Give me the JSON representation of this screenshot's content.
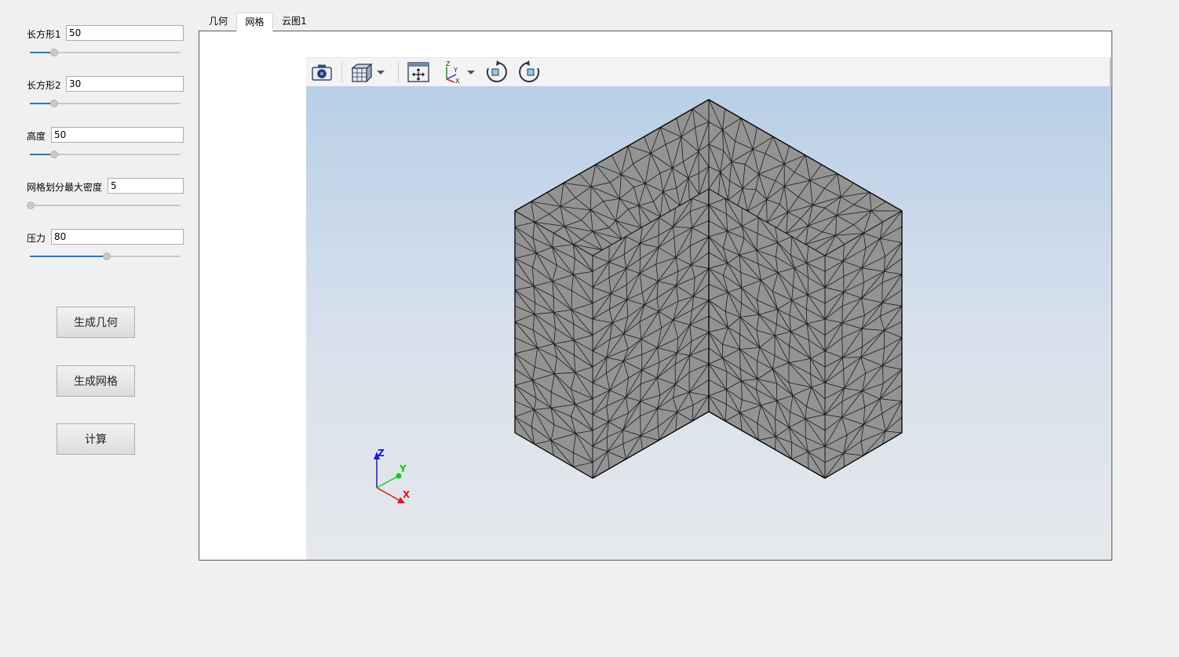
{
  "params": [
    {
      "label": "长方形1",
      "value": "50",
      "slider_fraction": 0.16
    },
    {
      "label": "长方形2",
      "value": "30",
      "slider_fraction": 0.16
    },
    {
      "label": "高度",
      "value": "50",
      "slider_fraction": 0.16
    },
    {
      "label": "网格划分最大密度",
      "value": "5",
      "slider_fraction": 0.0
    },
    {
      "label": "压力",
      "value": "80",
      "slider_fraction": 0.51
    }
  ],
  "buttons": {
    "generate_geometry": "生成几何",
    "generate_mesh": "生成网格",
    "compute": "计算"
  },
  "tabs": [
    {
      "label": "几何",
      "active": false
    },
    {
      "label": "网格",
      "active": true
    },
    {
      "label": "云图1",
      "active": false
    }
  ],
  "toolbar_icons": [
    "camera-icon",
    "view-cube-icon",
    "fit-all-icon",
    "axis-orientation-icon",
    "rotate-clockwise-icon",
    "rotate-counterclockwise-icon"
  ],
  "axes": {
    "x": "X",
    "y": "Y",
    "z": "Z"
  },
  "colors": {
    "accent": "#1e7ad4",
    "mesh_fill": "#939393",
    "background_top": "#b9cfe6",
    "background_bottom": "#e6e8ec",
    "axis_x": "#e01818",
    "axis_y": "#18c818",
    "axis_z": "#1818d8"
  }
}
